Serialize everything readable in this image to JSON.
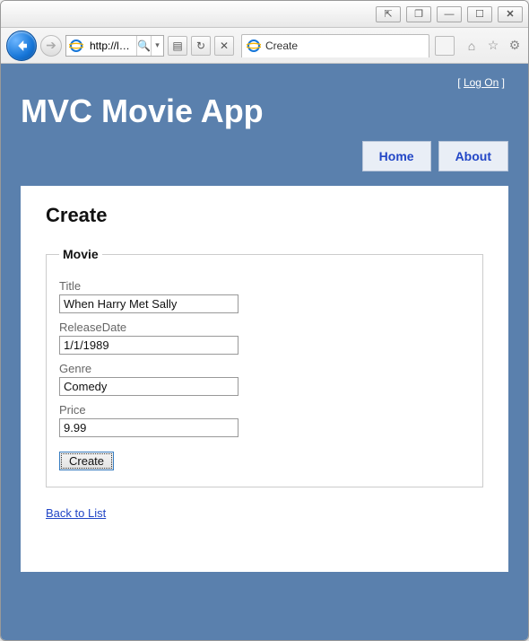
{
  "window": {
    "address": "http://loc...",
    "tab_title": "Create"
  },
  "titlebar_buttons": {
    "expand": "⇱",
    "restore": "❐",
    "min": "—",
    "max": "☐",
    "close": "✕"
  },
  "toolbar": {
    "search_icon": "🔍",
    "dropdown_icon": "▾",
    "refresh_icon": "↻",
    "stop_icon": "✕",
    "tabstrip_icon": "▤",
    "home_icon": "⌂",
    "fav_icon": "☆",
    "gear_icon": "⚙"
  },
  "account": {
    "left_bracket": "[ ",
    "logon": "Log On",
    "right_bracket": " ]"
  },
  "site_title": "MVC Movie App",
  "menu": {
    "home": "Home",
    "about": "About"
  },
  "page": {
    "heading": "Create",
    "legend": "Movie",
    "fields": {
      "title_label": "Title",
      "title_value": "When Harry Met Sally",
      "releasedate_label": "ReleaseDate",
      "releasedate_value": "1/1/1989",
      "genre_label": "Genre",
      "genre_value": "Comedy",
      "price_label": "Price",
      "price_value": "9.99"
    },
    "submit_label": "Create",
    "back_link": "Back to List"
  }
}
